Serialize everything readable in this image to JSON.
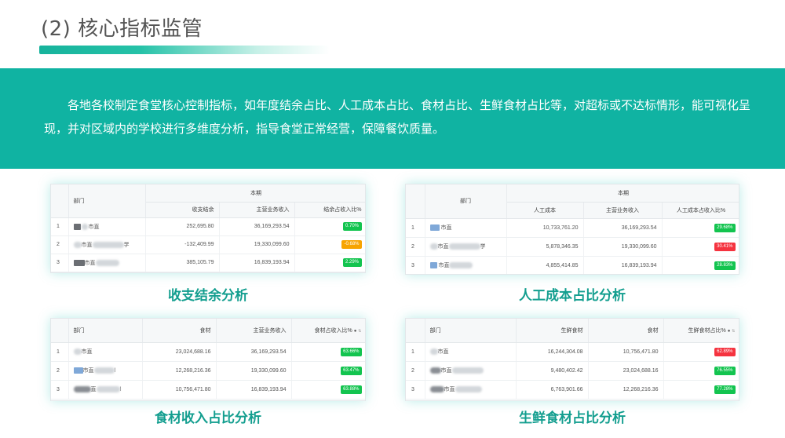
{
  "header": {
    "title": "(2) 核心指标监管"
  },
  "banner": {
    "text": "各地各校制定食堂核心控制指标，如年度结余占比、人工成本占比、食材占比、生鲜食材占比等，对超标或不达标情形，能可视化呈现，并对区域内的学校进行多维度分析，指导食堂正常经营，保障餐饮质量。"
  },
  "colors": {
    "accent": "#10b3a2",
    "caption": "#139e8f",
    "good": "#13c44f",
    "warn": "#f7a400",
    "bad": "#f5333f"
  },
  "panels": {
    "balance": {
      "caption": "收支结余分析",
      "group_header": "本期",
      "headers": {
        "dept": "部门",
        "c1": "收支结余",
        "c2": "主营业务收入",
        "c3": "结余占收入比%"
      },
      "rows": [
        {
          "idx": "1",
          "dept": "市直",
          "c1": "252,695.80",
          "c2": "36,169,293.54",
          "badge": "0.70%",
          "status": "green"
        },
        {
          "idx": "2",
          "dept": "市直",
          "dept_tail": "学",
          "c1": "-132,409.99",
          "c2": "19,330,099.60",
          "badge": "-0.68%",
          "status": "orange"
        },
        {
          "idx": "3",
          "dept": "市直",
          "c1": "385,105.79",
          "c2": "16,839,193.94",
          "badge": "2.29%",
          "status": "green"
        }
      ]
    },
    "labor": {
      "caption": "人工成本占比分析",
      "group_header": "本期",
      "headers": {
        "dept": "部门",
        "c1": "人工成本",
        "c2": "主营业务收入",
        "c3": "人工成本占收入比%"
      },
      "rows": [
        {
          "idx": "1",
          "dept": "市直",
          "c1": "10,733,761.20",
          "c2": "36,169,293.54",
          "badge": "29.68%",
          "status": "green"
        },
        {
          "idx": "2",
          "dept": "市直",
          "dept_tail": "学",
          "c1": "5,878,346.35",
          "c2": "19,330,099.60",
          "badge": "30.41%",
          "status": "red"
        },
        {
          "idx": "3",
          "dept": "市直",
          "c1": "4,855,414.85",
          "c2": "16,839,193.94",
          "badge": "28.83%",
          "status": "green"
        }
      ]
    },
    "food": {
      "caption": "食材收入占比分析",
      "headers": {
        "dept": "部门",
        "c1": "食材",
        "c2": "主营业务收入",
        "c3": "食材占收入比%"
      },
      "rows": [
        {
          "idx": "1",
          "dept": "市直",
          "c1": "23,024,688.16",
          "c2": "36,169,293.54",
          "badge": "63.66%",
          "status": "green"
        },
        {
          "idx": "2",
          "dept": "市直",
          "dept_tail": "l",
          "c1": "12,268,216.36",
          "c2": "19,330,099.60",
          "badge": "63.47%",
          "status": "green"
        },
        {
          "idx": "3",
          "dept": "直",
          "dept_tail": "l",
          "c1": "10,756,471.80",
          "c2": "16,839,193.94",
          "badge": "63.88%",
          "status": "green"
        }
      ]
    },
    "fresh": {
      "caption": "生鲜食材占比分析",
      "headers": {
        "dept": "部门",
        "c1": "生鲜食材",
        "c2": "食材",
        "c3": "生鲜食材占比%"
      },
      "rows": [
        {
          "idx": "1",
          "dept": "市直",
          "c1": "16,244,304.08",
          "c2": "10,756,471.80",
          "badge": "62.89%",
          "status": "red"
        },
        {
          "idx": "2",
          "dept": "市直",
          "c1": "9,480,402.42",
          "c2": "23,024,688.16",
          "badge": "76.55%",
          "status": "green"
        },
        {
          "idx": "3",
          "dept": "市直",
          "c1": "6,763,901.66",
          "c2": "12,268,216.36",
          "badge": "77.28%",
          "status": "green"
        }
      ]
    }
  }
}
